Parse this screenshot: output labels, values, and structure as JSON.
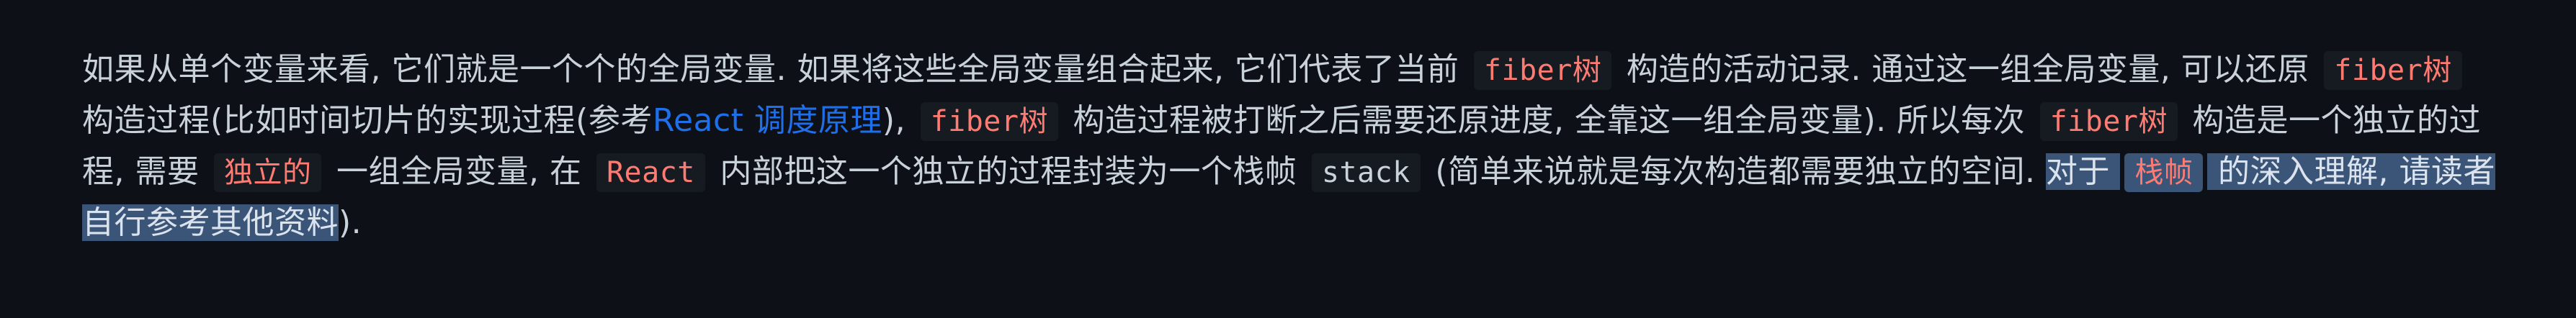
{
  "paragraph": {
    "t1": "如果从单个变量来看, 它们就是一个个的全局变量. 如果将这些全局变量组合起来, 它们代表了当前",
    "c1": "fiber树",
    "t2": "构造的活动记录. 通过这一组全局变量, 可以还原",
    "c2": "fiber树",
    "t3": "构造过程(比如时间切片的实现过程(参考",
    "link": "React 调度原理",
    "t4": "),",
    "c3": "fiber树",
    "t5": "构造过程被打断之后需要还原进度, 全靠这一组全局变量). 所以每次",
    "c4": "fiber树",
    "t6": "构造是一个独立的过程, 需要",
    "c5": "独立的",
    "t7": "一组全局变量, 在",
    "c6": "React",
    "t8": "内部把这一个独立的过程封装为一个栈帧",
    "c7": "stack",
    "t9": "(简单来说就是每次构造都需要独立的空间.",
    "s1": "对于",
    "c8": "栈帧",
    "s2": "的深入理解, 请读者自行参考其他资料",
    "t10": ")."
  },
  "colors": {
    "background": "#0d1117",
    "text": "#c9d1d9",
    "inline_code": "#ff7b72",
    "link": "#1f6feb",
    "selection": "#3b5578"
  }
}
